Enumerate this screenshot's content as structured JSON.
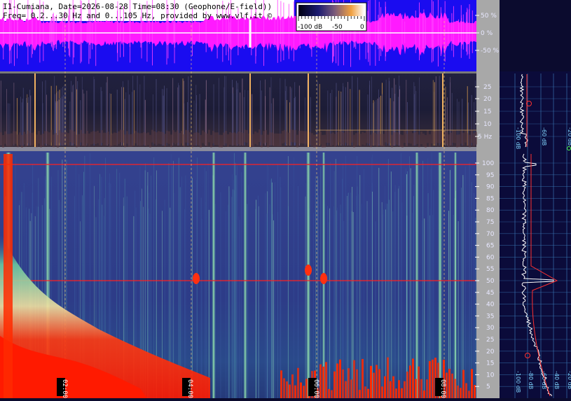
{
  "header": {
    "line1": "I1-Cumiana, Date=2026-08-28 Time=08:30 (Geophone/E-field))",
    "line2": "Freq= 0.2...30 Hz and 0...105 Hz, provided by www.vlf.it ©"
  },
  "colorbar": {
    "labels": [
      "-100 dB",
      "-50",
      "0"
    ]
  },
  "colors": {
    "waveform_bg": "#1a0cf0",
    "waveform_signal": "#ff1aff",
    "spectrogram_bg": "#2b3a86",
    "spectrum_bg": "#0b0b3a",
    "marker_line": "#ff2020",
    "time_marker": "#ffd070"
  },
  "chart_data": [
    {
      "type": "area",
      "name_panel": "waveform",
      "ylabel_ticks": [
        "50 %",
        "0 %",
        "-50 %"
      ],
      "ylim": [
        -100,
        100
      ]
    },
    {
      "type": "heatmap",
      "name_panel": "low-band spectrogram",
      "y_ticks": [
        "25",
        "20",
        "15",
        "10",
        "5 Hz"
      ],
      "ylim": [
        0.2,
        30
      ]
    },
    {
      "type": "heatmap",
      "name_panel": "full-band spectrogram",
      "y_ticks": [
        "100",
        "95",
        "90",
        "85",
        "80",
        "75",
        "70",
        "65",
        "60",
        "55",
        "50",
        "45",
        "40",
        "35",
        "30",
        "25",
        "20",
        "15",
        "10",
        "5"
      ],
      "ylim": [
        0,
        105
      ],
      "x_ticks": [
        "02:00",
        "04:00",
        "06:00",
        "08:00"
      ],
      "markers_hz": [
        100,
        50
      ]
    },
    {
      "type": "line",
      "name_panel": "low-band average spectrum",
      "x_ticks": [
        "-100 dB",
        "-80 dB",
        "-60 dB",
        "-40 dB",
        "-20 dB"
      ]
    },
    {
      "type": "line",
      "name_panel": "full-band average spectrum",
      "x_ticks": [
        "-100 dB",
        "-80 dB",
        "-60 dB",
        "-40 dB",
        "-20 dB"
      ],
      "peaks_hz": [
        100,
        50
      ]
    }
  ]
}
